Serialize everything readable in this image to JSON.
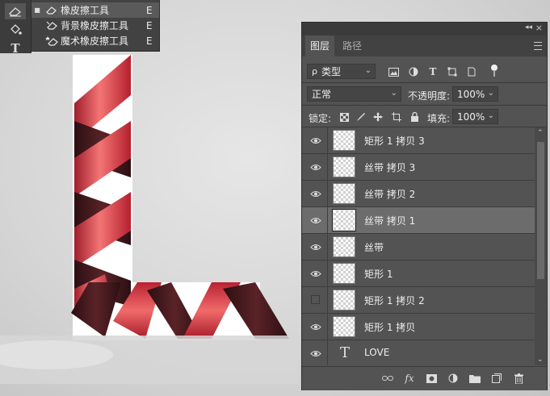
{
  "flyout": {
    "items": [
      {
        "label": "橡皮擦工具",
        "key": "E",
        "active": true,
        "icon": "eraser-icon"
      },
      {
        "label": "背景橡皮擦工具",
        "key": "E",
        "active": false,
        "icon": "background-eraser-icon"
      },
      {
        "label": "魔术橡皮擦工具",
        "key": "E",
        "active": false,
        "icon": "magic-eraser-icon"
      }
    ]
  },
  "toolbar": {
    "tools": [
      "eraser-icon",
      "paint-bucket-icon",
      "type-tool-icon"
    ],
    "type_glyph": "T"
  },
  "panel": {
    "collapse_glyph": "◂◂",
    "close_glyph": "×",
    "tabs": [
      "图层",
      "路径"
    ],
    "filter": {
      "value": "类型",
      "search_glyph": "ρ"
    },
    "blend_mode": "正常",
    "opacity_label": "不透明度:",
    "opacity_value": "100%",
    "lock_label": "锁定:",
    "fill_label": "填充:",
    "fill_value": "100%",
    "layers": [
      {
        "name": "矩形 1 拷贝 3",
        "visible": true,
        "type": "raster",
        "selected": false
      },
      {
        "name": "丝带 拷贝 3",
        "visible": true,
        "type": "raster",
        "selected": false
      },
      {
        "name": "丝带 拷贝 2",
        "visible": true,
        "type": "raster",
        "selected": false
      },
      {
        "name": "丝带 拷贝 1",
        "visible": true,
        "type": "raster",
        "selected": true
      },
      {
        "name": "丝带",
        "visible": true,
        "type": "raster",
        "selected": false
      },
      {
        "name": "矩形 1",
        "visible": true,
        "type": "raster",
        "selected": false
      },
      {
        "name": "矩形 1 拷贝 2",
        "visible": false,
        "type": "raster",
        "selected": false
      },
      {
        "name": "矩形 1 拷贝",
        "visible": true,
        "type": "raster",
        "selected": false
      },
      {
        "name": "LOVE",
        "visible": true,
        "type": "text",
        "selected": false
      }
    ],
    "text_thumb_glyph": "T",
    "bottom_fx": "fx"
  },
  "colors": {
    "ribbon_light": "#f26a6a",
    "ribbon_mid": "#c8283a",
    "ribbon_dark": "#3a1418",
    "panel_bg": "#535353"
  }
}
